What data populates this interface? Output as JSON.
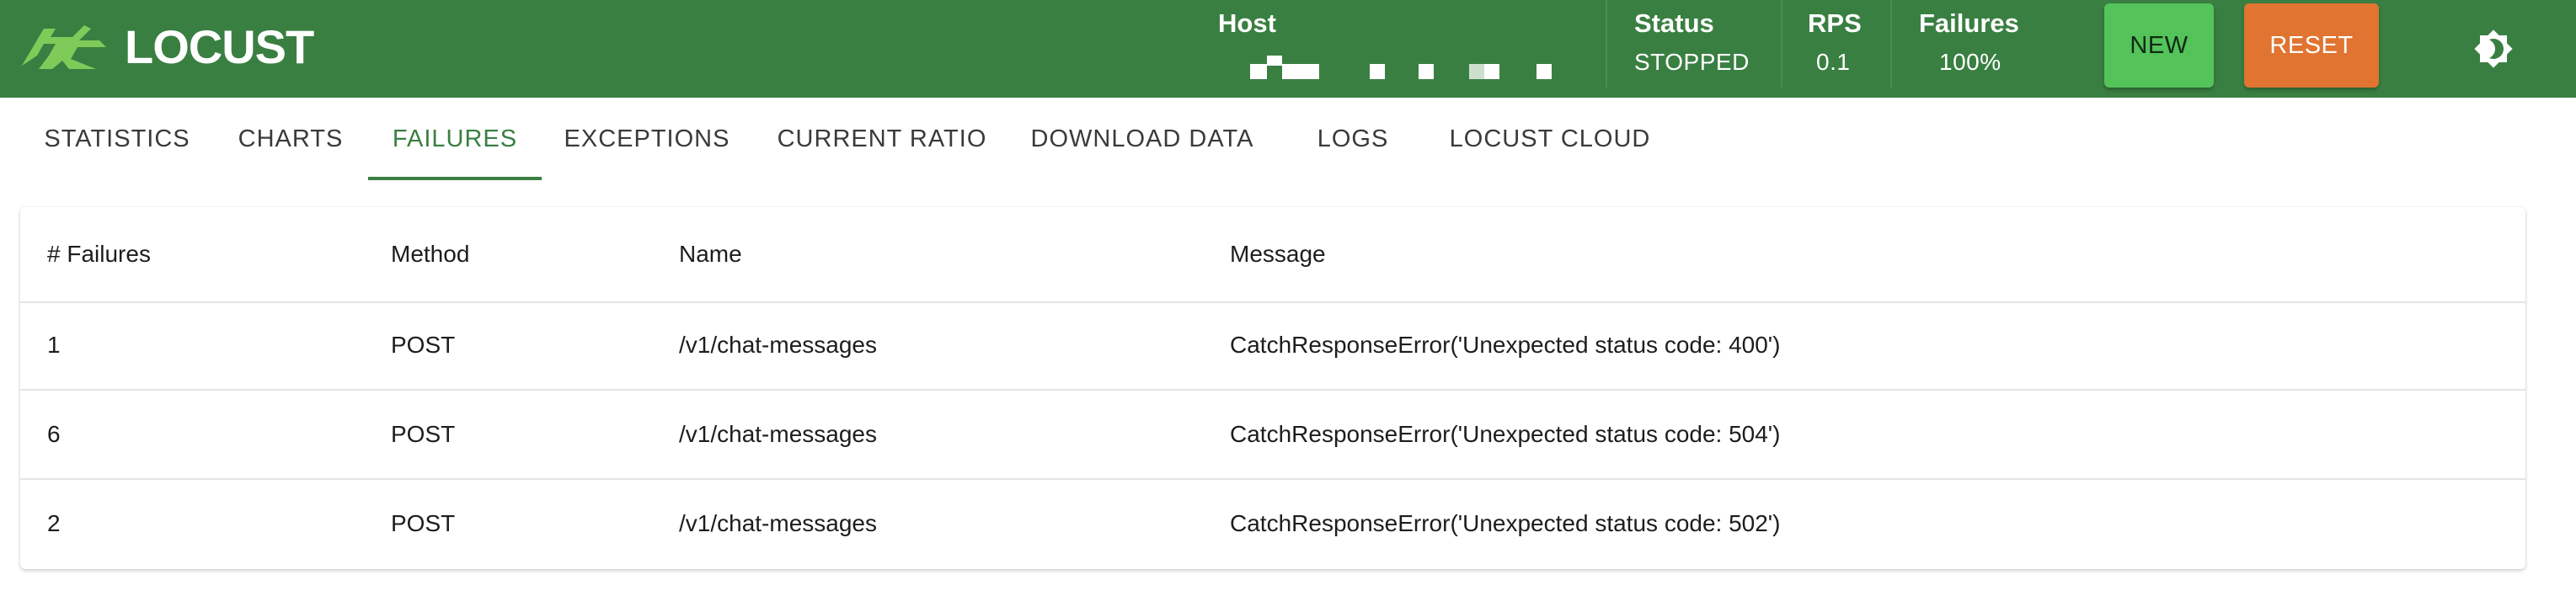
{
  "header": {
    "logo_text": "LOCUST",
    "host_label": "Host",
    "status_label": "Status",
    "status_value": "STOPPED",
    "rps_label": "RPS",
    "rps_value": "0.1",
    "failures_label": "Failures",
    "failures_value": "100%",
    "new_button": "NEW",
    "reset_button": "RESET",
    "theme_icon": "brightness-icon"
  },
  "colors": {
    "header_bg": "#3a7f42",
    "new_button": "#53c35a",
    "reset_button": "#e07430",
    "active_tab": "#3a7f42"
  },
  "tabs": [
    {
      "label": "STATISTICS"
    },
    {
      "label": "CHARTS"
    },
    {
      "label": "FAILURES"
    },
    {
      "label": "EXCEPTIONS"
    },
    {
      "label": "CURRENT RATIO"
    },
    {
      "label": "DOWNLOAD DATA"
    },
    {
      "label": "LOGS"
    },
    {
      "label": "LOCUST CLOUD"
    }
  ],
  "active_tab": "FAILURES",
  "table": {
    "columns": [
      "# Failures",
      "Method",
      "Name",
      "Message"
    ],
    "rows": [
      {
        "failures": "1",
        "method": "POST",
        "name": "/v1/chat-messages",
        "message": "CatchResponseError('Unexpected status code: 400')"
      },
      {
        "failures": "6",
        "method": "POST",
        "name": "/v1/chat-messages",
        "message": "CatchResponseError('Unexpected status code: 504')"
      },
      {
        "failures": "2",
        "method": "POST",
        "name": "/v1/chat-messages",
        "message": "CatchResponseError('Unexpected status code: 502')"
      }
    ]
  }
}
